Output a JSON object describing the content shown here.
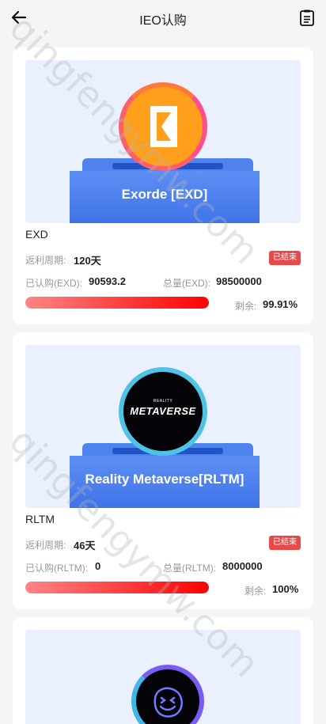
{
  "header": {
    "title": "IEO认购"
  },
  "watermark": "qingfengymw.com",
  "projects": [
    {
      "banner_label": "Exorde [EXD]",
      "symbol": "EXD",
      "period_label": "返利周期:",
      "period_value": "120天",
      "status": "已结束",
      "subscribed_label": "已认购(EXD):",
      "subscribed_value": "90593.2",
      "total_label": "总量(EXD):",
      "total_value": "98500000",
      "remaining_label": "剩余:",
      "remaining_value": "99.91%",
      "progress_fraction": 1.0
    },
    {
      "banner_label": "Reality Metaverse[RLTM]",
      "coin_small_text": "REALITY",
      "coin_big_text": "METAVERSE",
      "symbol": "RLTM",
      "period_label": "返利周期:",
      "period_value": "46天",
      "status": "已结束",
      "subscribed_label": "已认购(RLTM):",
      "subscribed_value": "0",
      "total_label": "总量(RLTM):",
      "total_value": "8000000",
      "remaining_label": "剩余:",
      "remaining_value": "100%",
      "progress_fraction": 1.0
    }
  ],
  "icons": {
    "back": "arrow-left-icon",
    "records": "document-list-icon",
    "exd_coin": "exorde-logo-icon",
    "rltm_coin": "reality-metaverse-logo-icon",
    "third_coin": "smiley-face-logo-icon"
  },
  "colors": {
    "accent": "#4f84ef",
    "badge": "#e84848",
    "progress": "#ff0000",
    "page_bg": "#f3f5f7"
  }
}
